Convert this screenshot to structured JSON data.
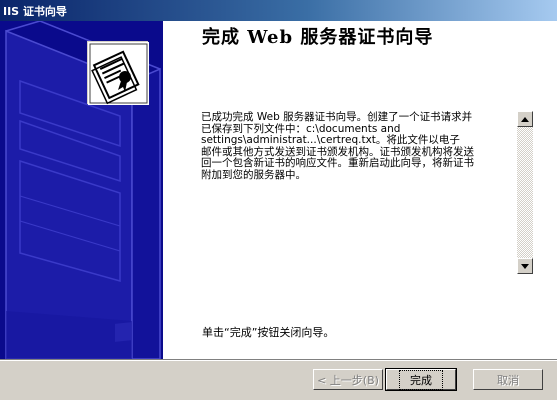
{
  "window": {
    "title": "IIS 证书向导"
  },
  "wizard": {
    "heading": "完成 Web 服务器证书向导",
    "message": "已成功完成 Web 服务器证书向导。创建了一个证书请求并\n已保存到下列文件中：c:\\documents and\nsettings\\administrat...\\certreq.txt。将此文件以电子\n邮件或其他方式发送到证书颁发机构。证书颁发机构将发送\n回一个包含新证书的响应文件。重新启动此向导，将新证书\n附加到您的服务器中。",
    "finish_hint": "单击“完成”按钮关闭向导。"
  },
  "buttons": {
    "back": "< 上一步(B)",
    "finish": "完成",
    "cancel": "取消"
  },
  "colors": {
    "art_background": "#0a0a8c",
    "title_gradient_start": "#0a246a",
    "face": "#d4d0c8"
  },
  "icons": {
    "wizard_art": "server-tower-illustration",
    "certificate": "certificate-icon",
    "scroll_up": "arrow-up-icon",
    "scroll_down": "arrow-down-icon"
  }
}
